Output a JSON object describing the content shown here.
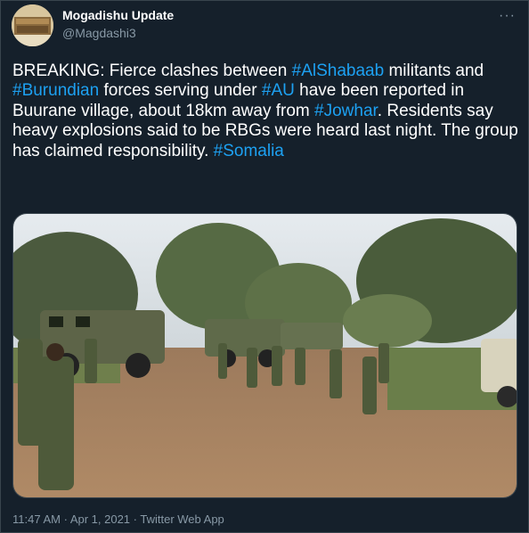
{
  "tweet": {
    "display_name": "Mogadishu Update",
    "handle": "@Magdashi3",
    "more_label": "···",
    "text_segments": [
      {
        "text": "BREAKING: Fierce clashes between ",
        "type": "text"
      },
      {
        "text": "#AlShabaab",
        "type": "hashtag"
      },
      {
        "text": " militants and ",
        "type": "text"
      },
      {
        "text": "#Burundian",
        "type": "hashtag"
      },
      {
        "text": " forces serving under ",
        "type": "text"
      },
      {
        "text": "#AU",
        "type": "hashtag"
      },
      {
        "text": " have been reported in Buurane village, about 18km away from ",
        "type": "text"
      },
      {
        "text": "#Jowhar",
        "type": "hashtag"
      },
      {
        "text": ". Residents say heavy explosions said to be RBGs were heard last night. The group has claimed responsibility. ",
        "type": "text"
      },
      {
        "text": "#Somalia",
        "type": "hashtag"
      }
    ],
    "time": "11:47 AM",
    "date": "Apr 1, 2021",
    "source": "Twitter Web App",
    "separator": " · "
  },
  "colors": {
    "background": "#15202b",
    "hashtag": "#1da1f2",
    "secondary_text": "#8899a6",
    "border": "#38444d"
  },
  "icons": {
    "more": "more-horizontal-icon"
  }
}
